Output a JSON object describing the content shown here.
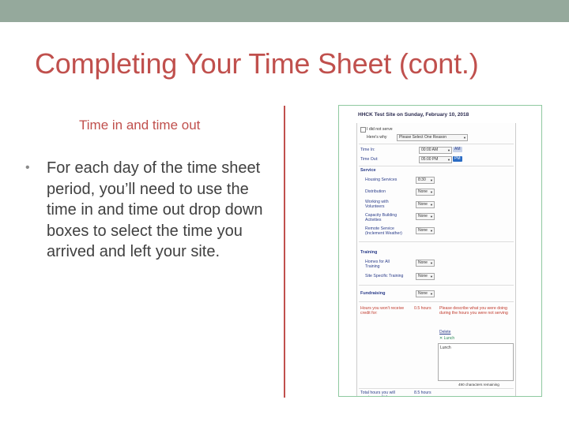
{
  "slide": {
    "title": "Completing Your Time Sheet (cont.)",
    "subheading": "Time in and time out",
    "bullet": "For each day of the time sheet period, you’ll need to use the time in and time out drop down boxes to select the time you arrived and left your site.",
    "bullet_glyph": "•"
  },
  "colors": {
    "topbar": "#95a99c",
    "title": "#c0504d",
    "body_text": "#404040",
    "divider": "#c0504d",
    "form_blue": "#2b3d8a",
    "form_red": "#c0392b"
  },
  "form": {
    "title": "HHCK Test Site on Sunday, February 10, 2018",
    "did_not_serve": "I did not serve",
    "heres_why": "Here's why",
    "reason_select": "Please Select One Reason",
    "time_in_label": "Time In:",
    "time_in_value": "00:00 AM",
    "time_in_ampm": "AM",
    "time_out_label": "Time Out:",
    "time_out_value": "05:00 PM",
    "time_out_ampm": "PM",
    "service_section": "Service",
    "service_rows": [
      {
        "label": "Housing Services",
        "value": "8:30"
      },
      {
        "label": "Distribution",
        "value": "None"
      },
      {
        "label": "Working with Volunteers",
        "value": "None"
      },
      {
        "label": "Capacity Building Activities",
        "value": "None"
      },
      {
        "label": "Remote Service (Inclement Weather)",
        "value": "None"
      }
    ],
    "training_section": "Training",
    "training_rows": [
      {
        "label": "Homes for All Training",
        "value": "None"
      },
      {
        "label": "Site Specific Training",
        "value": "None"
      }
    ],
    "fundraising_label": "Fundraising",
    "fundraising_value": "None",
    "no_credit_label": "Hours you won't receive credit for:",
    "no_credit_value": "0.5 hours",
    "describe_note": "Please describe what you were doing during the hours you were not serving",
    "lunch_link": "Delete",
    "lunch_item": "Lunch",
    "lunch_box_text": "Lunch",
    "chars_remaining": "490 characters remaining",
    "total_label": "Total hours you will receive credit for:",
    "total_value": "8.5 hours"
  }
}
